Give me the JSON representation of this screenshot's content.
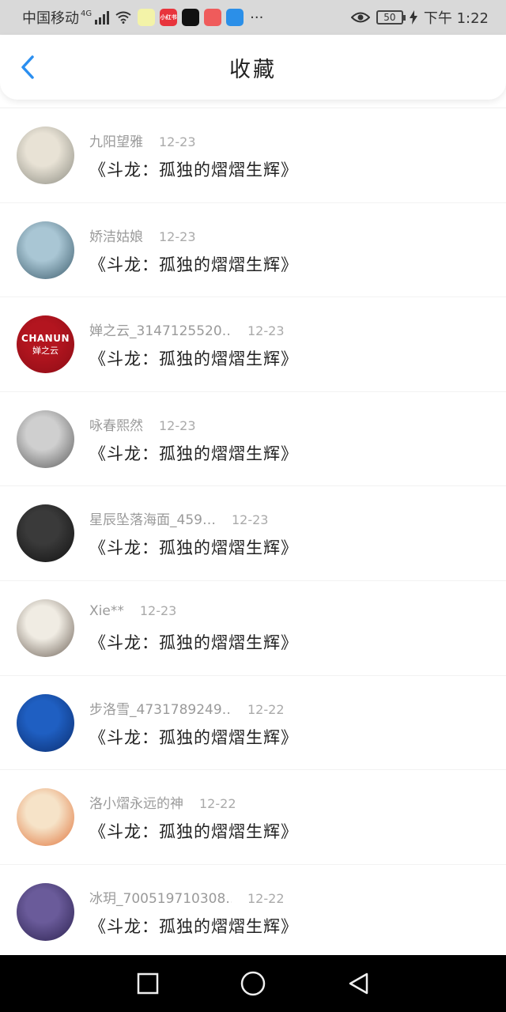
{
  "status_bar": {
    "carrier": "中国移动",
    "network": "4G",
    "battery": "50",
    "time": "下午 1:22",
    "more": "···",
    "app_icons": [
      {
        "name": "app-icon-1",
        "color": "#f3f3a8"
      },
      {
        "name": "xiaohongshu-icon",
        "label": "小红书",
        "color": "#e8343c"
      },
      {
        "name": "tiktok-icon",
        "color": "#111111"
      },
      {
        "name": "app-icon-4",
        "color": "#ef5b5b"
      },
      {
        "name": "app-icon-5",
        "color": "#2b8fe8"
      }
    ]
  },
  "header": {
    "title": "收藏"
  },
  "favorites": [
    {
      "name": "九阳望雅",
      "date": "12-23",
      "title": "《斗龙：孤独的熠熠生辉》",
      "avatar_colors": [
        "#e8e2d5",
        "#8a8a80"
      ]
    },
    {
      "name": "娇洁姑娘",
      "date": "12-23",
      "title": "《斗龙：孤独的熠熠生辉》",
      "avatar_colors": [
        "#a9c6d4",
        "#3a5a6a"
      ]
    },
    {
      "name": "婵之云_3147125520…",
      "date": "12-23",
      "title": "《斗龙：孤独的熠熠生辉》",
      "avatar_colors": [
        "#b3151f",
        "#8c0d16"
      ],
      "avatar_text": "CHANUN",
      "avatar_sub": "婵之云"
    },
    {
      "name": "咏春熙然",
      "date": "12-23",
      "title": "《斗龙：孤独的熠熠生辉》",
      "avatar_colors": [
        "#cfcfcf",
        "#5a5a5a"
      ]
    },
    {
      "name": "星辰坠落海面_459…",
      "date": "12-23",
      "title": "《斗龙：孤独的熠熠生辉》",
      "avatar_colors": [
        "#3a3a3a",
        "#111111"
      ]
    },
    {
      "name": "Xie**",
      "date": "12-23",
      "title": "《斗龙：孤独的熠熠生辉》",
      "avatar_colors": [
        "#f0ece3",
        "#6b5f55"
      ]
    },
    {
      "name": "步洛雪_4731789249…",
      "date": "12-22",
      "title": "《斗龙：孤独的熠熠生辉》",
      "avatar_colors": [
        "#1f5fc2",
        "#0b2d6e"
      ]
    },
    {
      "name": "洛小熠永远的神",
      "date": "12-22",
      "title": "《斗龙：孤独的熠熠生辉》",
      "avatar_colors": [
        "#f6e3c8",
        "#e0733a"
      ]
    },
    {
      "name": "冰玥_700519710308…",
      "date": "12-22",
      "title": "《斗龙：孤独的熠熠生辉》",
      "avatar_colors": [
        "#6a5b9a",
        "#2c2250"
      ]
    }
  ]
}
